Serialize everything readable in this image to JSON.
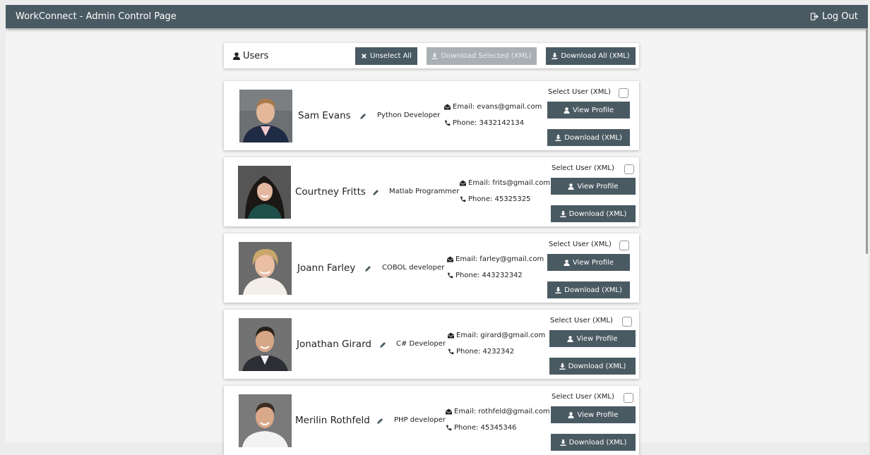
{
  "app": {
    "title": "WorkConnect - Admin Control Page",
    "logout_label": "Log Out"
  },
  "toolbar": {
    "title": "Users",
    "unselect_all": "Unselect All",
    "download_selected": "Download Selected (XML)",
    "download_all": "Download All (XML)"
  },
  "labels": {
    "select_user": "Select User (XML)",
    "view_profile": "View Profile",
    "download": "Download (XML)"
  },
  "users": [
    {
      "name": "Sam Evans",
      "role": "Python Developer",
      "email": "Email: evans@gmail.com",
      "phone": "Phone: 3432142134",
      "selected": false
    },
    {
      "name": "Courtney Fritts",
      "role": "Matlab Programmer",
      "email": "Email: frits@gmail.com",
      "phone": "Phone: 45325325",
      "selected": false
    },
    {
      "name": "Joann Farley",
      "role": "COBOL developer",
      "email": "Email: farley@gmail.com",
      "phone": "Phone: 443232342",
      "selected": false
    },
    {
      "name": "Jonathan Girard",
      "role": "C# Developer",
      "email": "Email: girard@gmail.com",
      "phone": "Phone: 4232342",
      "selected": false
    },
    {
      "name": "Merilin Rothfeld",
      "role": "PHP developer",
      "email": "Email: rothfeld@gmail.com",
      "phone": "Phone: 45345346",
      "selected": false
    }
  ],
  "colors": {
    "navbar": "#4a5a63",
    "button": "#4a5a63",
    "button_disabled": "#a9b0b4",
    "background": "#f4f4f4"
  }
}
